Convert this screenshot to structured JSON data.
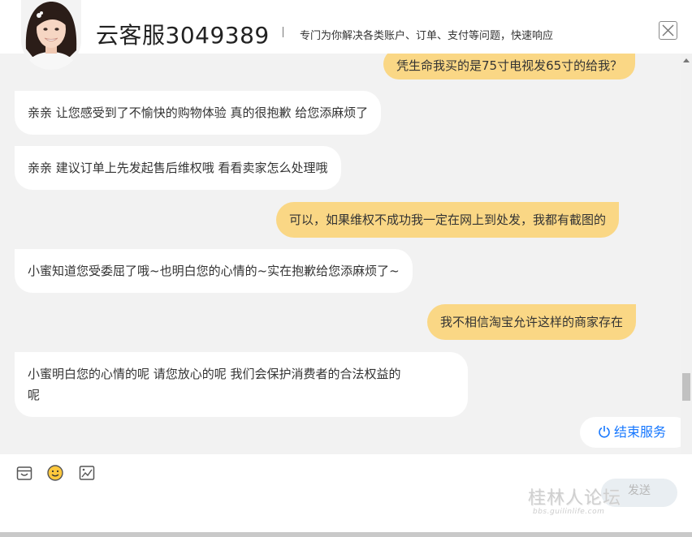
{
  "header": {
    "title": "云客服3049389",
    "subtitle": "专门为你解决各类账户、订单、支付等问题，快速响应"
  },
  "messages": [
    {
      "sender": "user",
      "text": "凭生命我买的是75寸电视发65寸的给我？"
    },
    {
      "sender": "agent",
      "text": "亲亲 让您感受到了不愉快的购物体验 真的很抱歉 给您添麻烦了"
    },
    {
      "sender": "agent",
      "text": "亲亲 建议订单上先发起售后维权哦 看看卖家怎么处理哦"
    },
    {
      "sender": "user",
      "text": "可以，如果维权不成功我一定在网上到处发，我都有截图的"
    },
    {
      "sender": "agent",
      "text": "小蜜知道您受委屈了哦~也明白您的心情的~实在抱歉给您添麻烦了~"
    },
    {
      "sender": "user",
      "text": "我不相信淘宝允许这样的商家存在"
    },
    {
      "sender": "agent",
      "text_line1": "小蜜明白您的心情的呢 请您放心的呢 我们会保护消费者的合法权益的",
      "text_line2": "呢"
    }
  ],
  "end_service": {
    "label": "结束服务",
    "icon": "power-icon"
  },
  "toolbar": {
    "icons": [
      "shop-icon",
      "emoji-icon",
      "image-icon"
    ],
    "send_label": "发送"
  },
  "watermark": {
    "main": "桂林人论坛",
    "url": "bbs.guilinlife.com"
  },
  "colors": {
    "user_bubble": "#fad785",
    "agent_bubble": "#ffffff",
    "chat_background": "#f2f2f2",
    "accent": "#1677ff"
  }
}
